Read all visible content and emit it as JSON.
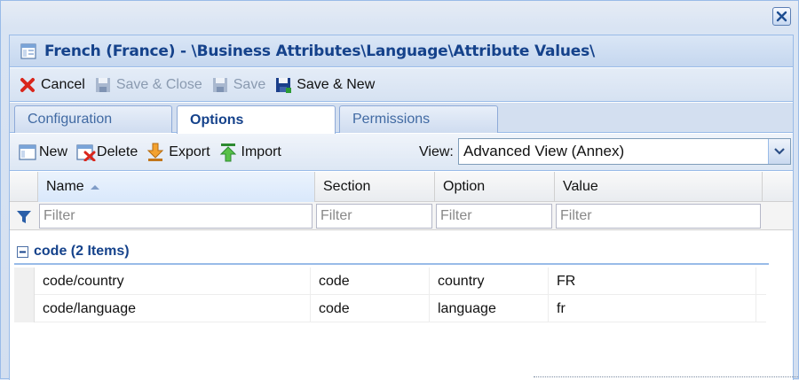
{
  "window": {
    "title": "French (France) - \\Business Attributes\\Language\\Attribute Values\\",
    "close_icon": "close-x-icon",
    "accent": "#15428b"
  },
  "toolbar": {
    "cancel": "Cancel",
    "save_close": "Save & Close",
    "save": "Save",
    "save_new": "Save & New"
  },
  "tabs": [
    {
      "label": "Configuration",
      "active": false
    },
    {
      "label": "Options",
      "active": true
    },
    {
      "label": "Permissions",
      "active": false
    }
  ],
  "subtoolbar": {
    "new": "New",
    "delete": "Delete",
    "export": "Export",
    "import": "Import",
    "view_label": "View:",
    "view_value": "Advanced View (Annex)"
  },
  "grid": {
    "columns": [
      "Name",
      "Section",
      "Option",
      "Value"
    ],
    "filter_placeholder": "Filter",
    "group_label": "code (2 Items)",
    "rows": [
      {
        "name": "code/country",
        "section": "code",
        "option": "country",
        "value": "FR"
      },
      {
        "name": "code/language",
        "section": "code",
        "option": "language",
        "value": "fr"
      }
    ]
  }
}
